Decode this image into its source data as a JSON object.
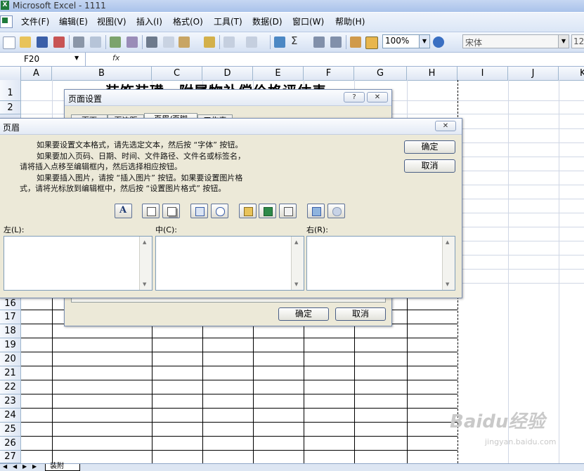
{
  "app": {
    "title": "Microsoft Excel - 1111"
  },
  "menu": [
    "文件(F)",
    "编辑(E)",
    "视图(V)",
    "插入(I)",
    "格式(O)",
    "工具(T)",
    "数据(D)",
    "窗口(W)",
    "帮助(H)"
  ],
  "toolbar": {
    "zoom": "100%",
    "font_name": "宋体",
    "font_size": "12"
  },
  "formula_bar": {
    "name_box": "F20",
    "fx": "fx"
  },
  "columns": [
    "A",
    "B",
    "C",
    "D",
    "E",
    "F",
    "G",
    "H",
    "I",
    "J",
    "K"
  ],
  "rows": [
    "1",
    "2",
    "16",
    "17",
    "18",
    "19",
    "20",
    "21",
    "22",
    "23",
    "24",
    "25",
    "26",
    "27"
  ],
  "sheet": {
    "title_text": "装饰装璜、附属物补偿价格评估表",
    "tab": "装附"
  },
  "page_setup": {
    "title": "页面设置",
    "help": "?",
    "close": "✕",
    "tabs": [
      "页面",
      "页边距",
      "页眉/页脚",
      "工作表"
    ],
    "ok": "确定",
    "cancel": "取消"
  },
  "header_dialog": {
    "title": "页眉",
    "close": "✕",
    "instructions": [
      "如果要设置文本格式，请先选定文本，然后按 “字体” 按钮。",
      "如果要加入页码、日期、时间、文件路径、文件名或标签名，",
      "请将插入点移至编辑框内，然后选择相应按钮。",
      "如果要插入图片，请按 “插入图片” 按钮。如果要设置图片格",
      "式，请将光标放到编辑框中，然后按 “设置图片格式” 按钮。"
    ],
    "ok": "确定",
    "cancel": "取消",
    "buttons": [
      "font",
      "page-number",
      "total-pages",
      "date",
      "time",
      "file-path",
      "file-name",
      "sheet-name",
      "insert-picture",
      "format-picture"
    ],
    "left_label": "左(L):",
    "center_label": "中(C):",
    "right_label": "右(R):"
  },
  "watermark": {
    "main": "Baidu经验",
    "sub": "jingyan.baidu.com"
  }
}
